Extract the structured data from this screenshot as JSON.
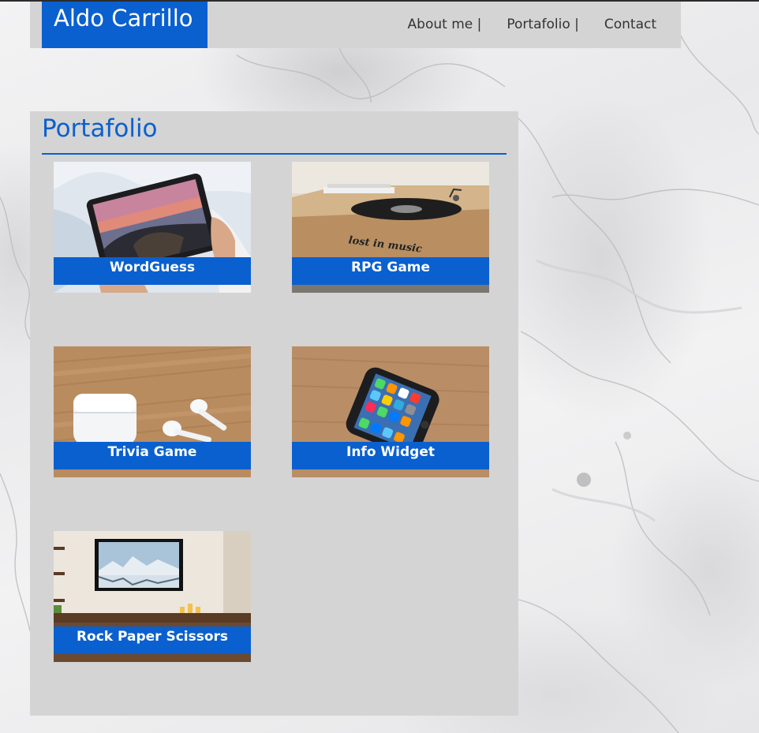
{
  "header": {
    "brand": "Aldo Carrillo",
    "nav": [
      {
        "label": "About me |"
      },
      {
        "label": "Portafolio |"
      },
      {
        "label": "Contact"
      }
    ]
  },
  "portfolio": {
    "title": "Portafolio",
    "projects": [
      {
        "label": "WordGuess",
        "image": "tablet-photo"
      },
      {
        "label": "RPG Game",
        "image": "turntable-photo",
        "image_text": "lost in music"
      },
      {
        "label": "Trivia Game",
        "image": "earbuds-photo"
      },
      {
        "label": "Info Widget",
        "image": "smartphone-photo"
      },
      {
        "label": "Rock Paper Scissors",
        "image": "tv-photo"
      }
    ]
  },
  "colors": {
    "accent": "#0a60cf",
    "panel": "#d4d4d4",
    "nav_text": "#333333"
  }
}
